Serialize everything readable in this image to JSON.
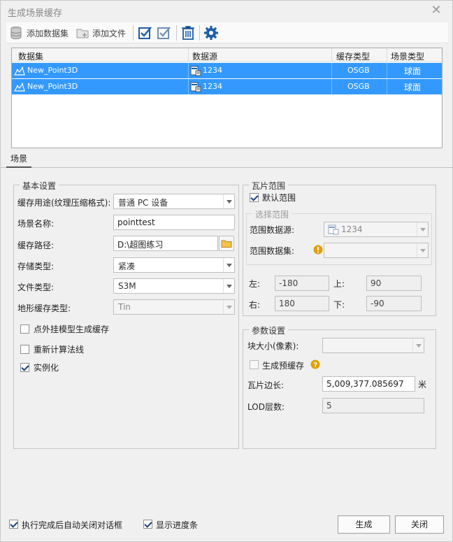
{
  "window": {
    "title": "生成场景缓存",
    "close_glyph": "✕"
  },
  "toolbar": {
    "add_dataset": "添加数据集",
    "add_file": "添加文件"
  },
  "grid": {
    "headers": [
      "数据集",
      "数据源",
      "缓存类型",
      "场景类型"
    ],
    "rows": [
      {
        "dataset": "New_Point3D",
        "datasource": "1234",
        "cache_type": "OSGB",
        "scene_type": "球面"
      },
      {
        "dataset": "New_Point3D",
        "datasource": "1234",
        "cache_type": "OSGB",
        "scene_type": "球面"
      }
    ],
    "selection_color": "#3399ff"
  },
  "tab": {
    "label": "场景"
  },
  "basic": {
    "title": "基本设置",
    "usage_label": "缓存用途(纹理压缩格式):",
    "usage_value": "普通 PC 设备",
    "name_label": "场景名称:",
    "name_value": "pointtest",
    "path_label": "缓存路径:",
    "path_value": "D:\\超图练习",
    "storage_label": "存储类型:",
    "storage_value": "紧凑",
    "filetype_label": "文件类型:",
    "filetype_value": "S3M",
    "terrain_label": "地形缓存类型:",
    "terrain_value": "Tin",
    "opt_external": "点外挂模型生成缓存",
    "opt_external_checked": false,
    "opt_normals": "重新计算法线",
    "opt_normals_checked": false,
    "opt_instance": "实例化",
    "opt_instance_checked": true
  },
  "tile_range": {
    "title": "瓦片范围",
    "default_range": "默认范围",
    "default_checked": true,
    "select_title": "选择范围",
    "range_ds_label": "范围数据源:",
    "range_ds_value": "1234",
    "range_set_label": "范围数据集:",
    "range_set_value": "",
    "left_label": "左:",
    "left_value": "-180",
    "top_label": "上:",
    "top_value": "90",
    "right_label": "右:",
    "right_value": "180",
    "bottom_label": "下:",
    "bottom_value": "-90"
  },
  "params": {
    "title": "参数设置",
    "block_label": "块大小(像素):",
    "block_value": "",
    "pre_cache": "生成预缓存",
    "pre_cache_checked": false,
    "tile_len_label": "瓦片边长:",
    "tile_len_value": "5,009,377.085697",
    "tile_len_unit": "米",
    "lod_label": "LOD层数:",
    "lod_value": "5"
  },
  "footer": {
    "auto_close": "执行完成后自动关闭对话框",
    "auto_close_checked": true,
    "show_progress": "显示进度条",
    "show_progress_checked": true,
    "generate": "生成",
    "close": "关闭"
  },
  "colors": {
    "accent": "#3399ff",
    "icon_blue": "#1f5fa8",
    "warning": "#e0a000"
  }
}
